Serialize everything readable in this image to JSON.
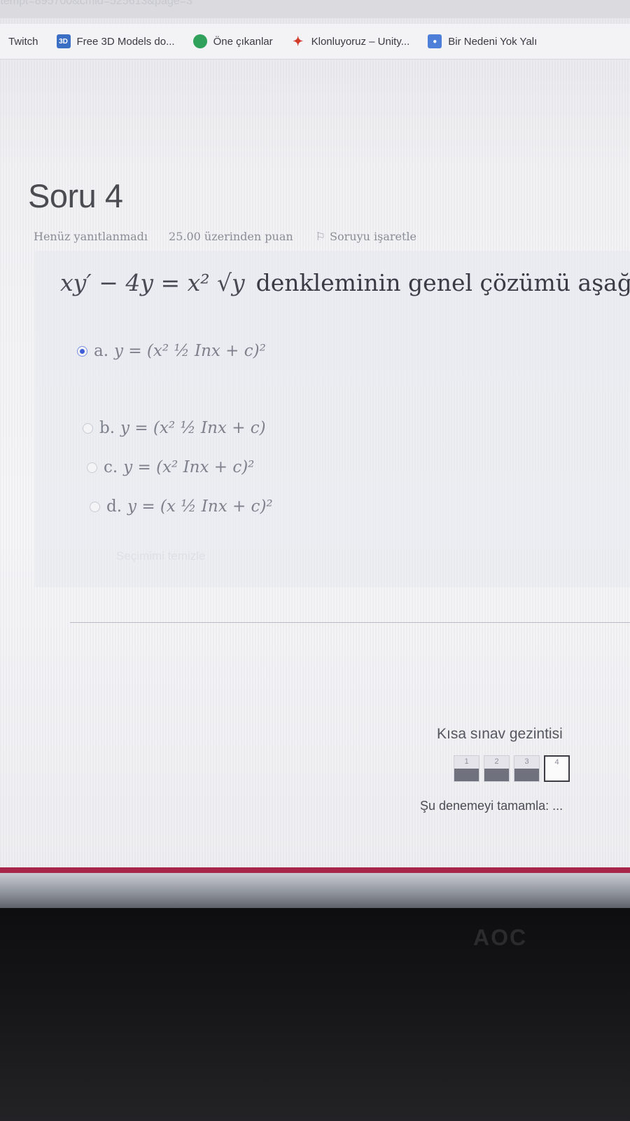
{
  "browser": {
    "url_fragment": "ttempt=895700&cmid=525613&page=3",
    "bookmarks": [
      {
        "label": "Twitch",
        "icon": "none"
      },
      {
        "label": "Free 3D Models do...",
        "icon": "3d-icon"
      },
      {
        "label": "Öne çıkanlar",
        "icon": "globe-icon"
      },
      {
        "label": "Klonluyoruz – Unity...",
        "icon": "sprite-icon"
      },
      {
        "label": "Bir Nedeni Yok Yalı",
        "icon": "bookmark-icon"
      }
    ]
  },
  "question": {
    "title": "Soru 4",
    "status": "Henüz yanıtlanmadı",
    "points": "25.00 üzerinden puan",
    "flag_label": "Soruyu işaretle",
    "equation": "xy′ − 4y = x² √y",
    "prompt": "denkleminin genel çözümü aşağ",
    "options": [
      {
        "letter": "a.",
        "text": "y = (x² ½ Inx + c)²",
        "selected": true
      },
      {
        "letter": "b.",
        "text": "y = (x² ½ Inx + c)",
        "selected": false
      },
      {
        "letter": "c.",
        "text": "y = (x² Inx + c)²",
        "selected": false
      },
      {
        "letter": "d.",
        "text": "y = (x ½ Inx + c)²",
        "selected": false
      }
    ],
    "clear_label": "Seçimimi temizle"
  },
  "quiz_nav": {
    "title": "Kısa sınav gezintisi",
    "buttons": [
      "1",
      "2",
      "3",
      "4"
    ],
    "current": "4",
    "finish_label": "Şu denemeyi tamamla: ..."
  },
  "monitor": {
    "brand": "AOC"
  },
  "colors": {
    "accent": "#3f5ed6",
    "band": "#a8264a"
  }
}
